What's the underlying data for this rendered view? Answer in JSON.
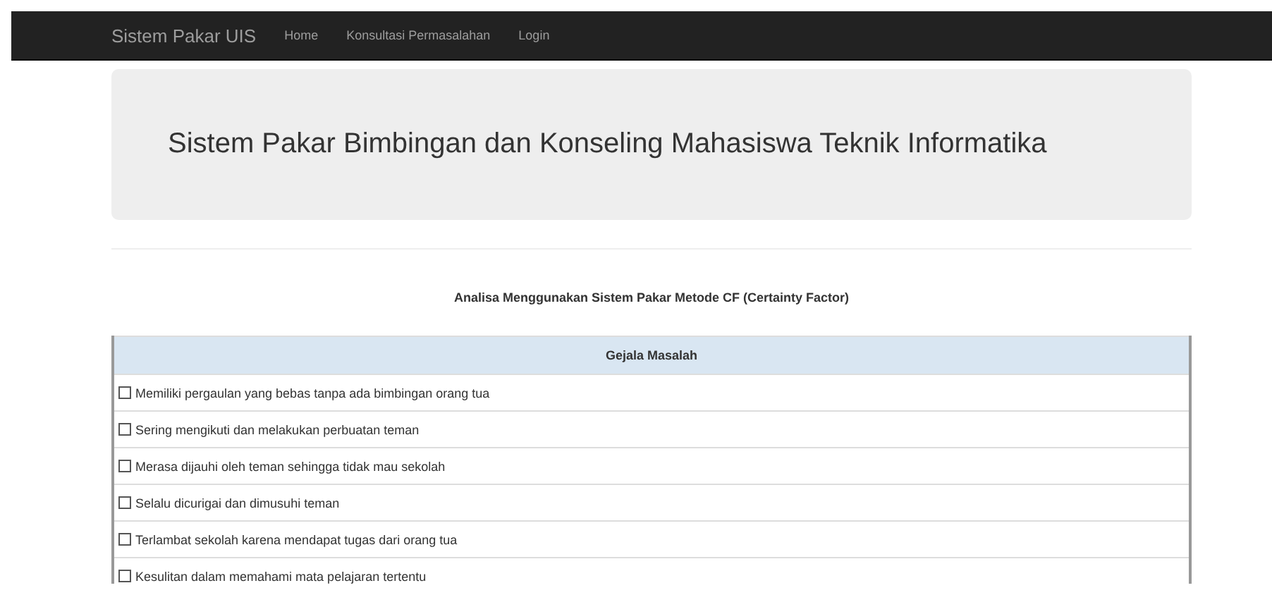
{
  "navbar": {
    "brand": "Sistem Pakar UIS",
    "links": [
      {
        "label": "Home",
        "selected": false
      },
      {
        "label": "Konsultasi Permasalahan",
        "selected": false
      },
      {
        "label": "Login",
        "selected": false
      }
    ]
  },
  "jumbotron": {
    "title": "Sistem Pakar Bimbingan dan Konseling Mahasiswa Teknik Informatika"
  },
  "subtitle": "Analisa Menggunakan Sistem Pakar Metode CF (Certainty Factor)",
  "table": {
    "columns": [
      "Gejala Masalah"
    ],
    "rows": [
      {
        "label": "Memiliki pergaulan yang bebas tanpa ada bimbingan orang tua",
        "checked": false
      },
      {
        "label": "Sering mengikuti dan melakukan perbuatan teman",
        "checked": false
      },
      {
        "label": "Merasa dijauhi oleh teman sehingga tidak mau sekolah",
        "checked": false
      },
      {
        "label": "Selalu dicurigai dan dimusuhi teman",
        "checked": false
      },
      {
        "label": "Terlambat sekolah karena mendapat tugas dari orang tua",
        "checked": false
      },
      {
        "label": "Kesulitan dalam memahami mata pelajaran tertentu",
        "checked": false
      }
    ]
  }
}
